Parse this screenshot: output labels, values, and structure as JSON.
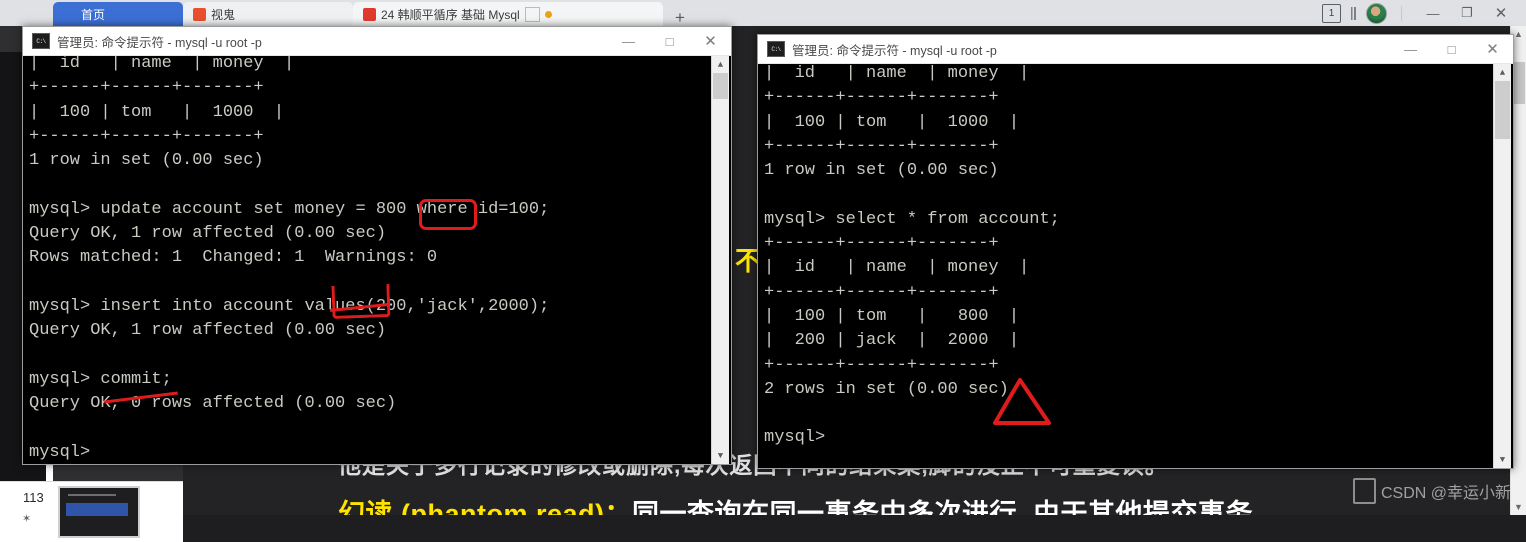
{
  "browser": {
    "tabs": [
      {
        "label": "首页",
        "favicon": "home-icon"
      },
      {
        "label": "视鬼",
        "favicon": "bilibili-icon"
      },
      {
        "label": "24 韩顺平循序 基础 Mysql",
        "favicon": "video-icon"
      }
    ],
    "new_tab_label": "+",
    "tab_count": "1",
    "window_controls": {
      "minimize": "—",
      "maximize": "❐",
      "close": "✕"
    }
  },
  "background_slide": {
    "line_top": "他是关于多行记录的修改或删除,每次返回不同的结果集,脚的没正不可重复读。",
    "phantom_label": "幻读 (phantom read)：",
    "phantom_text": "同一查询在同一事务中多次进行, 由于其他提交事务",
    "side_text": "不可重复读 每",
    "watermark": "CSDN @幸运小新",
    "thumbnail_number": "113",
    "accent_yellow": "#ffe400"
  },
  "left_window": {
    "title": "管理员: 命令提示符 - mysql  -u root -p",
    "icon": "console-icon",
    "controls": {
      "minimize": "—",
      "maximize": "□",
      "close": "✕"
    },
    "console_text": "|  id   | name  | money  |\n+------+------+-------+\n|  100 | tom   |  1000  |\n+------+------+-------+\n1 row in set (0.00 sec)\n\nmysql> update account set money = 800 where id=100;\nQuery OK, 1 row affected (0.00 sec)\nRows matched: 1  Changed: 1  Warnings: 0\n\nmysql> insert into account values(200,'jack',2000);\nQuery OK, 1 row affected (0.00 sec)\n\nmysql> commit;\nQuery OK, 0 rows affected (0.00 sec)\n\nmysql>",
    "scrollbar": {
      "up": "⌃",
      "down": "⌄"
    }
  },
  "right_window": {
    "title": "管理员: 命令提示符 - mysql  -u root -p",
    "icon": "console-icon",
    "controls": {
      "minimize": "—",
      "maximize": "□",
      "close": "✕"
    },
    "console_text": "|  id   | name  | money  |\n+------+------+-------+\n|  100 | tom   |  1000  |\n+------+------+-------+\n1 row in set (0.00 sec)\n\nmysql> select * from account;\n+------+------+-------+\n|  id   | name  | money  |\n+------+------+-------+\n|  100 | tom   |   800  |\n|  200 | jack  |  2000  |\n+------+------+-------+\n2 rows in set (0.00 sec)\n\nmysql> ",
    "scrollbar": {
      "up": "⌃",
      "down": "⌄"
    }
  },
  "annotations": {
    "highlight_value": "800",
    "marker_color": "#e01b1b"
  },
  "floating_buttons": [
    {
      "name": "add-page-icon"
    },
    {
      "name": "add-person-icon"
    }
  ]
}
